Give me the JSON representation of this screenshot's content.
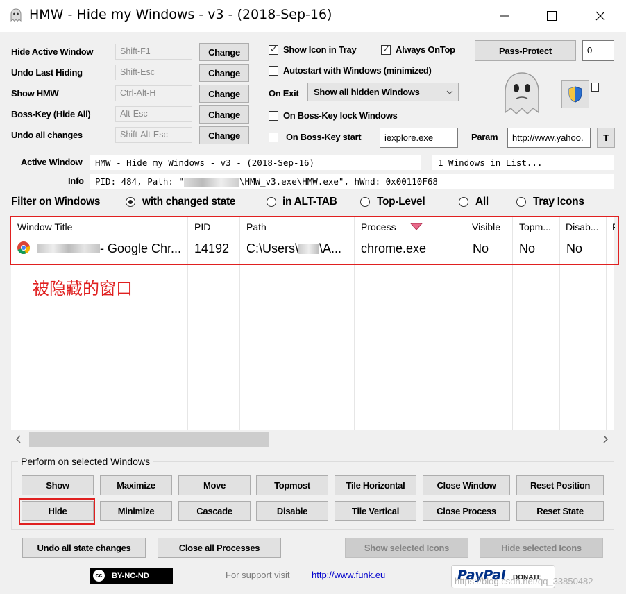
{
  "window": {
    "title": "HMW - Hide my Windows - v3 - (2018-Sep-16)"
  },
  "hotkeys": [
    {
      "label": "Hide Active Window",
      "value": "Shift-F1",
      "button": "Change"
    },
    {
      "label": "Undo Last Hiding",
      "value": "Shift-Esc",
      "button": "Change"
    },
    {
      "label": "Show HMW",
      "value": "Ctrl-Alt-H",
      "button": "Change"
    },
    {
      "label": "Boss-Key (Hide All)",
      "value": "Alt-Esc",
      "button": "Change"
    },
    {
      "label": "Undo all changes",
      "value": "Shift-Alt-Esc",
      "button": "Change"
    }
  ],
  "options": {
    "show_icon_tray": "Show Icon in Tray",
    "always_ontop": "Always OnTop",
    "autostart": "Autostart with Windows (minimized)",
    "on_exit_label": "On Exit",
    "on_exit_value": "Show all hidden Windows",
    "boss_key_lock": "On Boss-Key lock Windows",
    "boss_key_start": "On Boss-Key start",
    "boss_key_start_value": "iexplore.exe",
    "param_label": "Param",
    "param_value": "http://www.yahoo.",
    "param_button": "T",
    "pass_protect": "Pass-Protect",
    "pass_value": "0"
  },
  "info": {
    "active_window_label": "Active Window",
    "active_window_value": "HMW - Hide my Windows - v3 - (2018-Sep-16)",
    "count_value": "1 Windows in List...",
    "info_label": "Info",
    "info_value_pre": "PID: 484, Path: \"",
    "info_value_post": "\\HMW_v3.exe\\HMW.exe\", hWnd: 0x00110F68"
  },
  "filter": {
    "label": "Filter on Windows",
    "options": [
      "with changed state",
      "in ALT-TAB",
      "Top-Level",
      "All",
      "Tray Icons"
    ],
    "selected": "with changed state"
  },
  "table": {
    "headers": [
      "Window Title",
      "PID",
      "Path",
      "Process",
      "Visible",
      "Topm...",
      "Disab...",
      "F"
    ],
    "rows": [
      {
        "title": "- Google Chr...",
        "pid": "14192",
        "path_pre": "C:\\Users\\",
        "path_post": "\\A...",
        "process": "chrome.exe",
        "visible": "No",
        "topmost": "No",
        "disabled": "No"
      }
    ],
    "annotation": "被隐藏的窗口"
  },
  "actions": {
    "group_title": "Perform on selected Windows",
    "row1": [
      "Show",
      "Maximize",
      "Move",
      "Topmost",
      "Tile Horizontal",
      "Close Window",
      "Reset Position"
    ],
    "row2": [
      "Hide",
      "Minimize",
      "Cascade",
      "Disable",
      "Tile Vertical",
      "Close Process",
      "Reset State"
    ]
  },
  "bottom": {
    "undo_all": "Undo all state changes",
    "close_all": "Close all Processes",
    "show_icons": "Show selected Icons",
    "hide_icons": "Hide selected Icons",
    "license": "BY-NC-ND",
    "support_text": "For support visit",
    "support_link": "http://www.funk.eu",
    "paypal": "PayPal",
    "donate": "DONATE",
    "watermark": "https://blog.csdn.net/qq_33850482"
  },
  "colors": {
    "accent_red": "#e02020",
    "link_blue": "#0000cc",
    "paypal_dark": "#003087",
    "paypal_light": "#009cde"
  }
}
